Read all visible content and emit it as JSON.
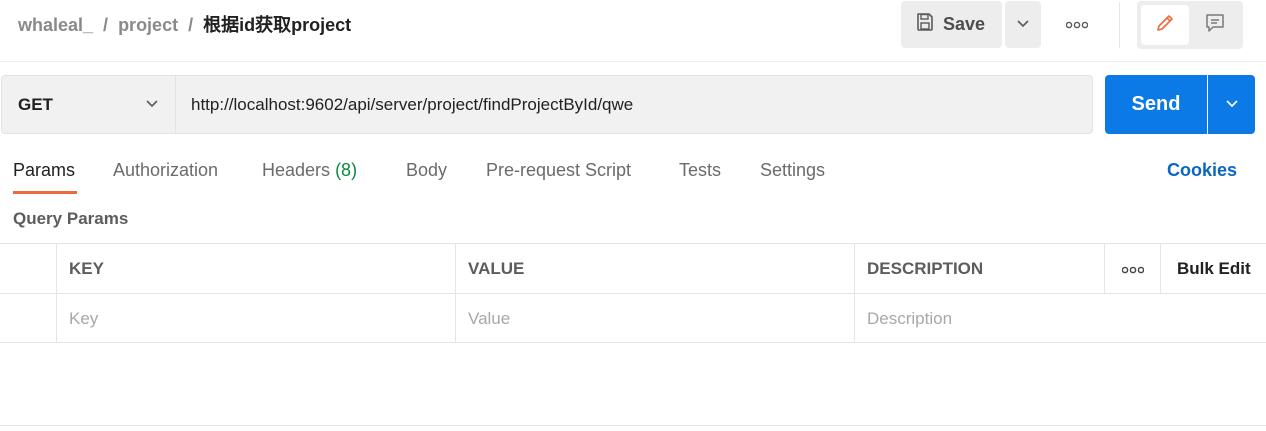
{
  "breadcrumb": {
    "workspace": "whaleal_",
    "collection": "project",
    "request": "根据id获取project",
    "separator": "/"
  },
  "toolbar": {
    "save_label": "Save",
    "icons": {
      "save": "save-icon",
      "caret": "chevron-down-icon",
      "more": "more-horizontal-icon",
      "edit": "pencil-icon",
      "comment": "comment-icon"
    },
    "accent": "#ef6a3a"
  },
  "request": {
    "method": "GET",
    "url": "http://localhost:9602/api/server/project/findProjectById/qwe",
    "send_label": "Send",
    "send_color": "#0b7ae6"
  },
  "tabs": [
    {
      "label": "Params",
      "active": true
    },
    {
      "label": "Authorization"
    },
    {
      "label": "Headers",
      "count": "(8)"
    },
    {
      "label": "Body"
    },
    {
      "label": "Pre-request Script"
    },
    {
      "label": "Tests"
    },
    {
      "label": "Settings"
    }
  ],
  "cookies_label": "Cookies",
  "query_params": {
    "title": "Query Params",
    "columns": {
      "key": "KEY",
      "value": "VALUE",
      "description": "DESCRIPTION",
      "bulk_edit": "Bulk Edit"
    },
    "placeholders": {
      "key": "Key",
      "value": "Value",
      "description": "Description"
    }
  }
}
